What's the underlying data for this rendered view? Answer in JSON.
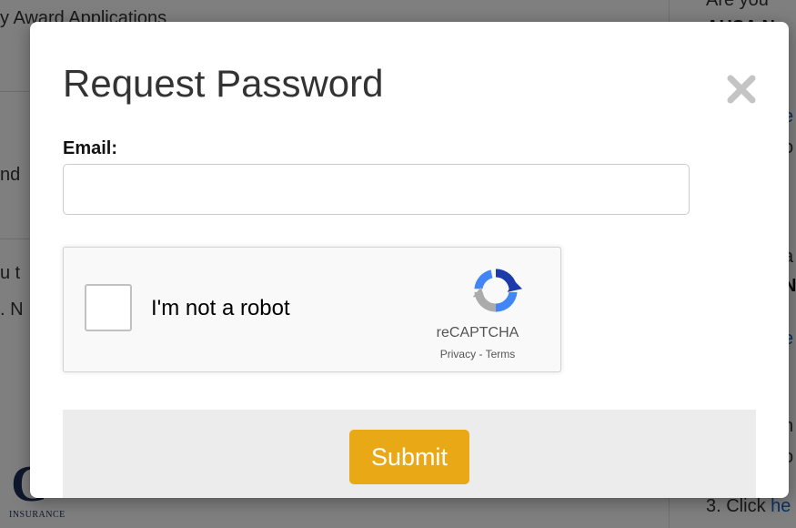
{
  "background": {
    "left_texts": [
      {
        "text": "y Award Applications"
      },
      {
        "text": "nd"
      },
      {
        "text": "u t"
      },
      {
        "text": ". N"
      }
    ],
    "right_texts": [
      {
        "text": "Are you"
      },
      {
        "text": "AHSA N"
      },
      {
        "text": "d"
      },
      {
        "text": "e"
      },
      {
        "text": "o"
      },
      {
        "text": "a"
      },
      {
        "text": "N"
      },
      {
        "text": "e"
      },
      {
        "text": "n"
      },
      {
        "text": "o"
      }
    ],
    "click_prefix": "3. Click ",
    "click_link": "he",
    "logo_letter": "C",
    "logo_sub": "INSURANCE"
  },
  "modal": {
    "title": "Request Password",
    "close_symbol": "×",
    "email": {
      "label": "Email:",
      "value": "",
      "placeholder": ""
    },
    "recaptcha": {
      "checkbox_label": "I'm not a robot",
      "brand": "reCAPTCHA",
      "privacy": "Privacy",
      "separator": " - ",
      "terms": "Terms"
    },
    "submit_label": "Submit"
  },
  "colors": {
    "accent": "#e9a916",
    "overlay": "rgba(0,0,0,0.5)",
    "footer": "#ececec",
    "link": "#1565c0"
  }
}
